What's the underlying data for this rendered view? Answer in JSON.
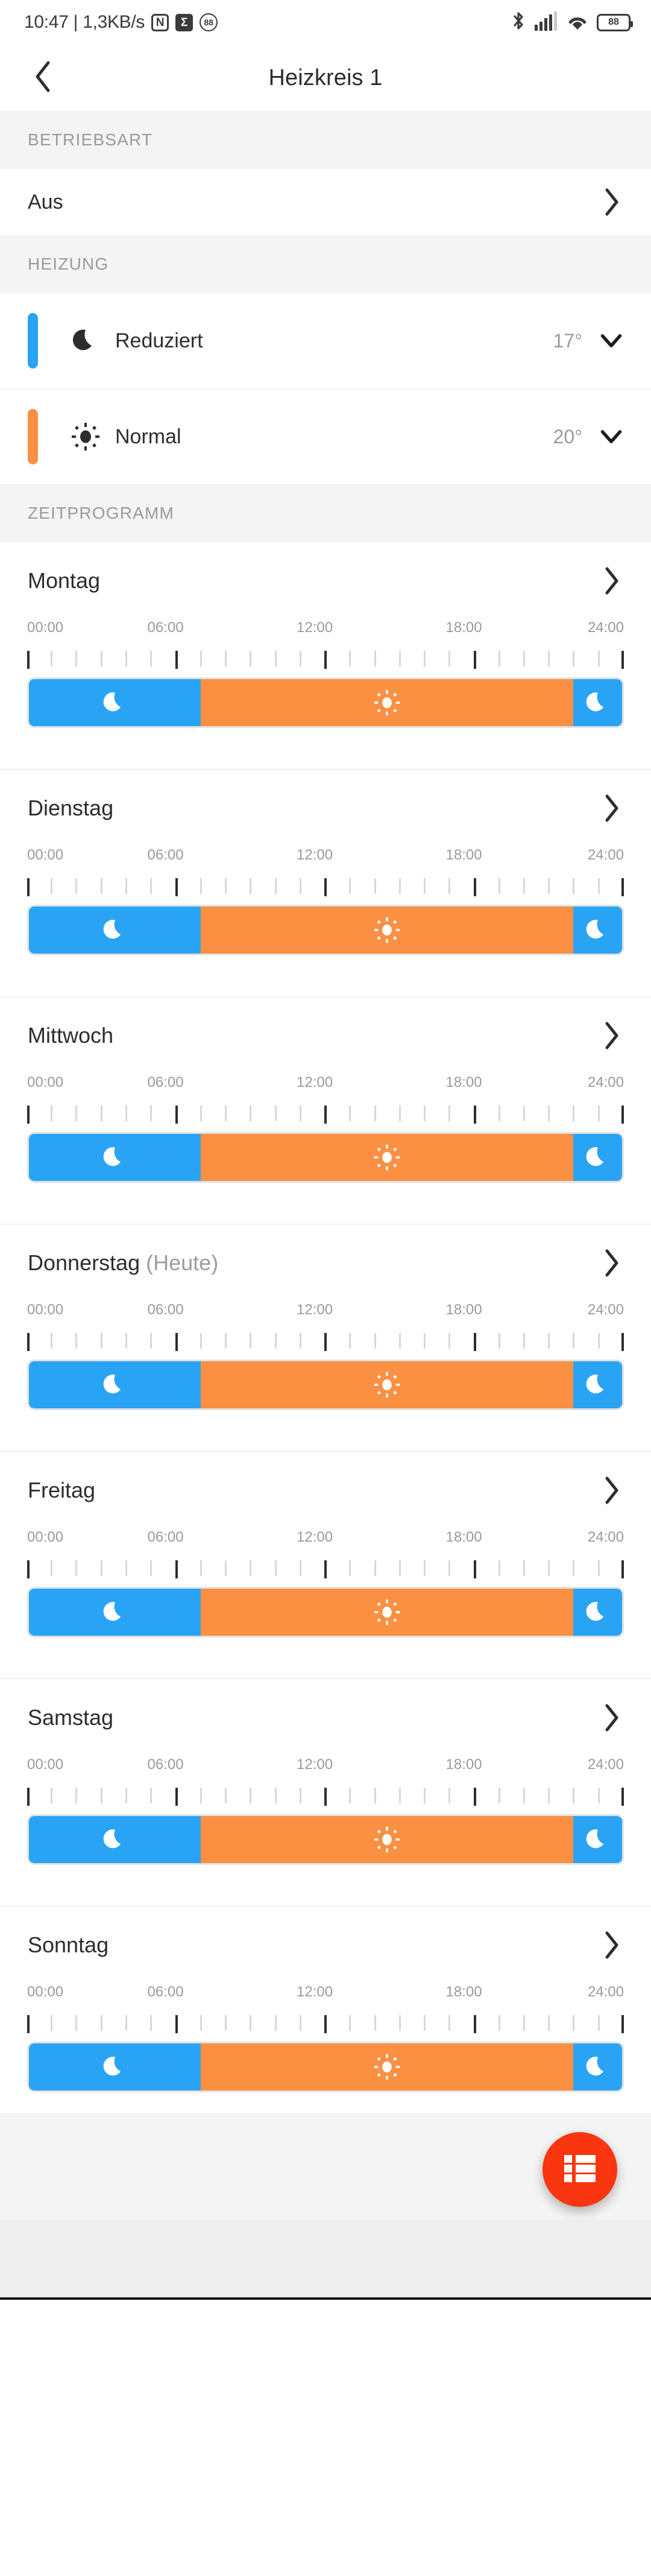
{
  "status_bar": {
    "clock": "10:47",
    "separator": "|",
    "network_speed": "1,3KB/s",
    "nfc_icon_label": "N",
    "sigma_icon_label": "Σ",
    "circle_badge_label": "88",
    "battery_label": "88",
    "icons": [
      "nfc-icon",
      "sigma-icon",
      "circle-88-icon",
      "bluetooth-icon",
      "signal-icon",
      "wifi-icon",
      "battery-icon"
    ]
  },
  "app_bar": {
    "back_icon": "chevron-left-icon",
    "title": "Heizkreis 1"
  },
  "sections": {
    "betriebsart": {
      "header": "BETRIEBSART",
      "row_label": "Aus",
      "chevron_icon": "chevron-right-icon"
    },
    "heizung": {
      "header": "HEIZUNG",
      "modes": [
        {
          "name": "Reduziert",
          "temperature": "17°",
          "icon": "moon-icon",
          "accent": "#29a4f5"
        },
        {
          "name": "Normal",
          "temperature": "20°",
          "icon": "sun-icon",
          "accent": "#fb9043"
        }
      ],
      "chevron_icon": "chevron-down-icon"
    },
    "zeitprogramm": {
      "header": "ZEITPROGRAMM",
      "chevron_icon": "chevron-right-icon",
      "axis_labels": [
        "00:00",
        "06:00",
        "12:00",
        "18:00",
        "24:00"
      ],
      "days": [
        {
          "name": "Montag",
          "today_suffix": "",
          "segments": [
            {
              "mode": "Reduziert",
              "icon": "moon-icon",
              "color": "#29a4f5",
              "start_pct": 0,
              "end_pct": 29
            },
            {
              "mode": "Normal",
              "icon": "sun-icon",
              "color": "#fb9043",
              "start_pct": 29,
              "end_pct": 91.8
            },
            {
              "mode": "Reduziert",
              "icon": "moon-icon",
              "color": "#29a4f5",
              "start_pct": 91.8,
              "end_pct": 100
            }
          ]
        },
        {
          "name": "Dienstag",
          "today_suffix": "",
          "segments": [
            {
              "mode": "Reduziert",
              "icon": "moon-icon",
              "color": "#29a4f5",
              "start_pct": 0,
              "end_pct": 29
            },
            {
              "mode": "Normal",
              "icon": "sun-icon",
              "color": "#fb9043",
              "start_pct": 29,
              "end_pct": 91.8
            },
            {
              "mode": "Reduziert",
              "icon": "moon-icon",
              "color": "#29a4f5",
              "start_pct": 91.8,
              "end_pct": 100
            }
          ]
        },
        {
          "name": "Mittwoch",
          "today_suffix": "",
          "segments": [
            {
              "mode": "Reduziert",
              "icon": "moon-icon",
              "color": "#29a4f5",
              "start_pct": 0,
              "end_pct": 29
            },
            {
              "mode": "Normal",
              "icon": "sun-icon",
              "color": "#fb9043",
              "start_pct": 29,
              "end_pct": 91.8
            },
            {
              "mode": "Reduziert",
              "icon": "moon-icon",
              "color": "#29a4f5",
              "start_pct": 91.8,
              "end_pct": 100
            }
          ]
        },
        {
          "name": "Donnerstag",
          "today_suffix": "(Heute)",
          "segments": [
            {
              "mode": "Reduziert",
              "icon": "moon-icon",
              "color": "#29a4f5",
              "start_pct": 0,
              "end_pct": 29
            },
            {
              "mode": "Normal",
              "icon": "sun-icon",
              "color": "#fb9043",
              "start_pct": 29,
              "end_pct": 91.8
            },
            {
              "mode": "Reduziert",
              "icon": "moon-icon",
              "color": "#29a4f5",
              "start_pct": 91.8,
              "end_pct": 100
            }
          ]
        },
        {
          "name": "Freitag",
          "today_suffix": "",
          "segments": [
            {
              "mode": "Reduziert",
              "icon": "moon-icon",
              "color": "#29a4f5",
              "start_pct": 0,
              "end_pct": 29
            },
            {
              "mode": "Normal",
              "icon": "sun-icon",
              "color": "#fb9043",
              "start_pct": 29,
              "end_pct": 91.8
            },
            {
              "mode": "Reduziert",
              "icon": "moon-icon",
              "color": "#29a4f5",
              "start_pct": 91.8,
              "end_pct": 100
            }
          ]
        },
        {
          "name": "Samstag",
          "today_suffix": "",
          "segments": [
            {
              "mode": "Reduziert",
              "icon": "moon-icon",
              "color": "#29a4f5",
              "start_pct": 0,
              "end_pct": 29
            },
            {
              "mode": "Normal",
              "icon": "sun-icon",
              "color": "#fb9043",
              "start_pct": 29,
              "end_pct": 91.8
            },
            {
              "mode": "Reduziert",
              "icon": "moon-icon",
              "color": "#29a4f5",
              "start_pct": 91.8,
              "end_pct": 100
            }
          ]
        },
        {
          "name": "Sonntag",
          "today_suffix": "",
          "segments": [
            {
              "mode": "Reduziert",
              "icon": "moon-icon",
              "color": "#29a4f5",
              "start_pct": 0,
              "end_pct": 29
            },
            {
              "mode": "Normal",
              "icon": "sun-icon",
              "color": "#fb9043",
              "start_pct": 29,
              "end_pct": 91.8
            },
            {
              "mode": "Reduziert",
              "icon": "moon-icon",
              "color": "#29a4f5",
              "start_pct": 91.8,
              "end_pct": 100
            }
          ]
        }
      ]
    }
  },
  "fab": {
    "icon": "list-icon",
    "color": "#f9360f"
  },
  "colors": {
    "blue": "#29a4f5",
    "orange": "#fb9043",
    "accent_red": "#f9360f",
    "section_bg": "#f4f4f4",
    "text_primary": "#2d2d2d",
    "text_secondary": "#9a9a9a"
  }
}
